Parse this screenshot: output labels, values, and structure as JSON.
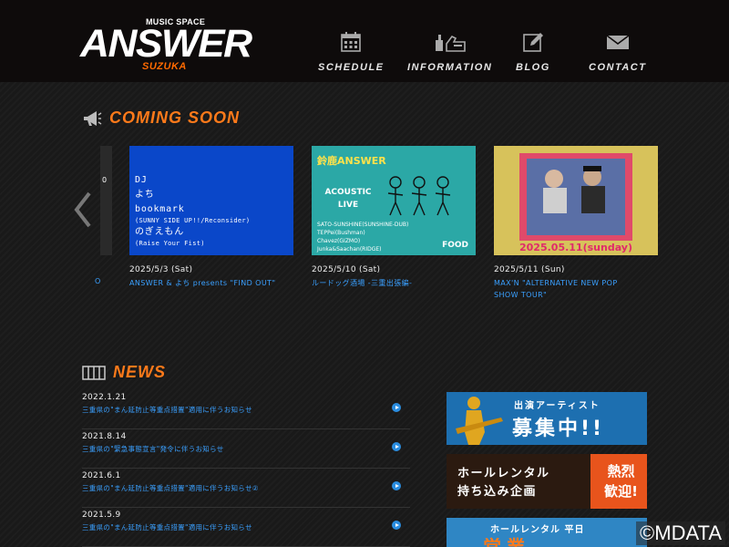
{
  "header": {
    "logo_small": "MUSIC SPACE",
    "logo_main": "ANSWER",
    "logo_sub": "SUZUKA",
    "nav": [
      {
        "label": "SCHEDULE",
        "icon": "calendar-icon"
      },
      {
        "label": "INFORMATION",
        "icon": "hands-icon"
      },
      {
        "label": "BLOG",
        "icon": "pencil-icon"
      },
      {
        "label": "CONTACT",
        "icon": "mail-icon"
      }
    ]
  },
  "coming_soon": {
    "title": "COMING SOON",
    "partial_title": "O",
    "partial_thumb_char": "0",
    "cards": [
      {
        "date": "2025/5/3 (Sat)",
        "title": "ANSWER & よち presents \"FIND OUT\"",
        "thumb_lines": [
          "DJ",
          "よち",
          "bookmark",
          "(SUNNY SIDE UP!!/Reconsider)",
          "のぎえもん",
          "(Raise Your Fist)"
        ]
      },
      {
        "date": "2025/5/10 (Sat)",
        "title": "ルードッグ酒場 -三重出張編-",
        "thumb_head": "鈴鹿ANSWER",
        "thumb_sub1": "ACOUSTIC",
        "thumb_sub2": "LIVE",
        "thumb_lines": [
          "SATO-SUNSHINE(SUNSHINE-DUB)",
          "TEPPei(Bushman)",
          "Chavez(GIZMO)",
          "Junka&Saachan(RIDGE)"
        ],
        "thumb_food": "FOOD"
      },
      {
        "date": "2025/5/11 (Sun)",
        "title_line1": "MAX'N \"ALTERNATIVE NEW POP",
        "title_line2": "SHOW TOUR\"",
        "thumb_date": "2025.05.11(sunday)"
      }
    ]
  },
  "news": {
    "title": "NEWS",
    "items": [
      {
        "date": "2022.1.21",
        "text": "三重県の\"まん延防止等重点措置\"適用に伴うお知らせ"
      },
      {
        "date": "2021.8.14",
        "text": "三重県の\"緊急事態宣言\"発令に伴うお知らせ"
      },
      {
        "date": "2021.6.1",
        "text": "三重県の\"まん延防止等重点措置\"適用に伴うお知らせ②"
      },
      {
        "date": "2021.5.9",
        "text": "三重県の\"まん延防止等重点措置\"適用に伴うお知らせ"
      }
    ]
  },
  "banners": {
    "artist": {
      "line1": "出演アーティスト",
      "line2": "募集中!!"
    },
    "rental": {
      "line1": "ホールレンタル",
      "line2": "持ち込み企画",
      "badge1": "熱烈",
      "badge2": "歓迎!"
    },
    "rental2": {
      "line1": "ホールレンタル 平日",
      "line2": "営業…"
    }
  },
  "watermark": "©MDATA",
  "colors": {
    "accent": "#ff7a1a",
    "link": "#3aa0ff",
    "header_bg": "#0e0b0b"
  }
}
